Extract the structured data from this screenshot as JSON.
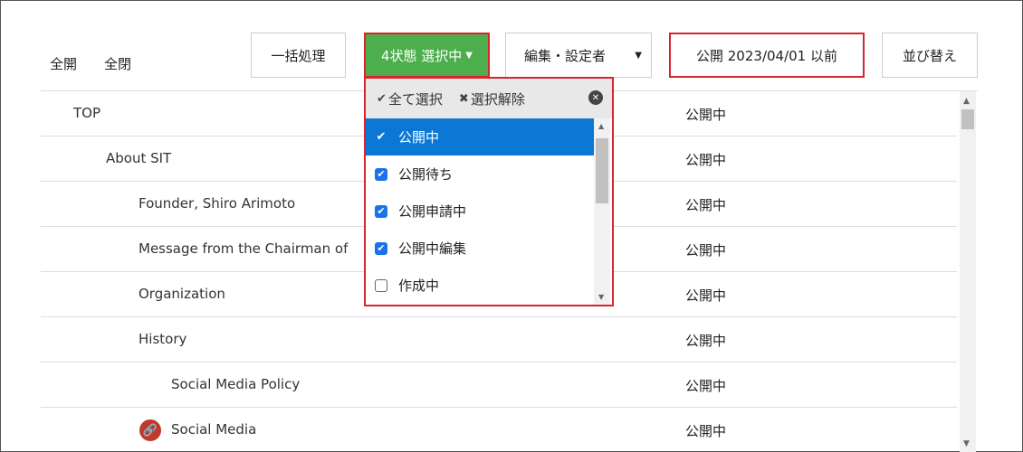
{
  "toolbar": {
    "expand_all": "全開",
    "collapse_all": "全閉",
    "bulk_process": "一括処理",
    "status_filter": "4状態 選択中",
    "editor_filter": "編集・設定者",
    "publish_date_filter": "公開 2023/04/01 以前",
    "sort": "並び替え"
  },
  "dropdown": {
    "select_all": "全て選択",
    "deselect_all": "選択解除",
    "options": [
      {
        "label": "公開中",
        "checked": true,
        "active": true
      },
      {
        "label": "公開待ち",
        "checked": true,
        "active": false
      },
      {
        "label": "公開申請中",
        "checked": true,
        "active": false
      },
      {
        "label": "公開中編集",
        "checked": true,
        "active": false
      },
      {
        "label": "作成中",
        "checked": false,
        "active": false
      }
    ]
  },
  "pages": [
    {
      "title": "TOP",
      "level": 0,
      "status": "公開中",
      "icon": ""
    },
    {
      "title": "About SIT",
      "level": 1,
      "status": "公開中",
      "icon": ""
    },
    {
      "title": "Founder, Shiro Arimoto",
      "level": 2,
      "status": "公開中",
      "icon": ""
    },
    {
      "title": "Message from the Chairman of",
      "level": 2,
      "status": "公開中",
      "icon": ""
    },
    {
      "title": "Organization",
      "level": 2,
      "status": "公開中",
      "icon": ""
    },
    {
      "title": "History",
      "level": 2,
      "status": "公開中",
      "icon": ""
    },
    {
      "title": "Social Media Policy",
      "level": 3,
      "status": "公開中",
      "icon": ""
    },
    {
      "title": "Social Media",
      "level": 3,
      "status": "公開中",
      "icon": "link-icon"
    }
  ],
  "colors": {
    "accent_green": "#4cae4c",
    "highlight_red": "#d9232e",
    "selection_blue": "#0a78d4",
    "link_icon": "#c0392b"
  }
}
